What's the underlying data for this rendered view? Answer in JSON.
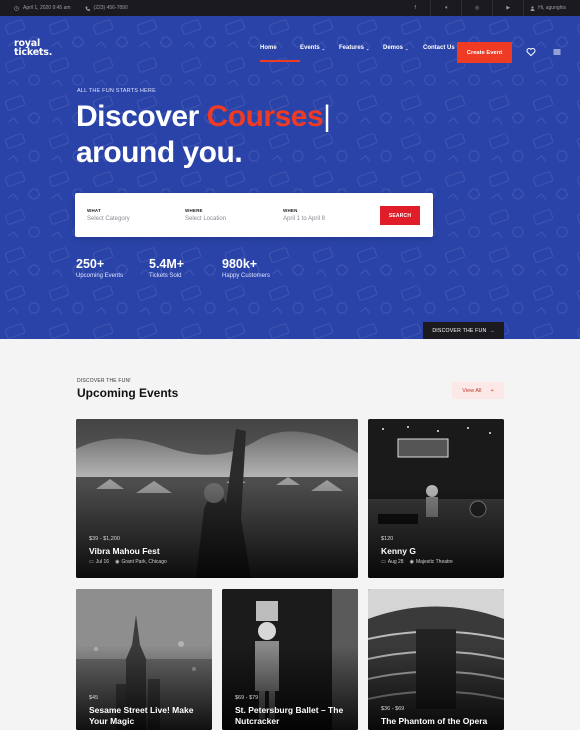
{
  "topbar": {
    "date": "April 1, 2020 9:45 am",
    "phone": "(223) 456-7890",
    "user": "Hi, agunghis",
    "social": [
      "facebook-icon",
      "twitter-icon",
      "instagram-icon",
      "youtube-icon"
    ]
  },
  "brand": {
    "line1": "royal",
    "line2": "tickets."
  },
  "nav": {
    "items": [
      {
        "label": "Home",
        "active": true,
        "dropdown": false
      },
      {
        "label": "Events",
        "active": false,
        "dropdown": true
      },
      {
        "label": "Features",
        "active": false,
        "dropdown": true
      },
      {
        "label": "Demos",
        "active": false,
        "dropdown": true
      },
      {
        "label": "Contact Us",
        "active": false,
        "dropdown": false
      }
    ],
    "cta": "Create Event"
  },
  "hero": {
    "kicker": "ALL THE FUN STARTS HERE",
    "headline_prefix": "Discover ",
    "headline_accent": "Courses",
    "headline_caret": "|",
    "headline_line2": "around you.",
    "search": {
      "what_label": "WHAT",
      "what_value": "Select Category",
      "where_label": "WHERE",
      "where_value": "Select Location",
      "when_label": "WHEN",
      "when_value": "April 1 to April 8",
      "button": "SEARCH"
    },
    "stats": [
      {
        "value": "250+",
        "caption": "Upcoming Events"
      },
      {
        "value": "5.4M+",
        "caption": "Tickets Sold"
      },
      {
        "value": "980k+",
        "caption": "Happy Customers"
      }
    ],
    "discover_button": "DISCOVER THE FUN",
    "bg_color": "#2a43a8",
    "accent_color": "#ef3a24"
  },
  "events": {
    "kicker": "DISCOVER THE FUN!",
    "title": "Upcoming Events",
    "view_all": "View All",
    "cards": [
      {
        "price": "$39 - $1,200",
        "title": "Vibra Mahou Fest",
        "date": "Jul 16",
        "location": "Grant Park, Chicago"
      },
      {
        "price": "$120",
        "title": "Kenny G",
        "date": "Aug 28",
        "location": "Majestic Theatre"
      },
      {
        "price": "$45",
        "title": "Sesame Street Live! Make Your Magic"
      },
      {
        "price": "$69 - $79",
        "title": "St. Petersburg Ballet – The Nutcracker"
      },
      {
        "price": "$36 - $69",
        "title": "The Phantom of the Opera"
      }
    ]
  }
}
